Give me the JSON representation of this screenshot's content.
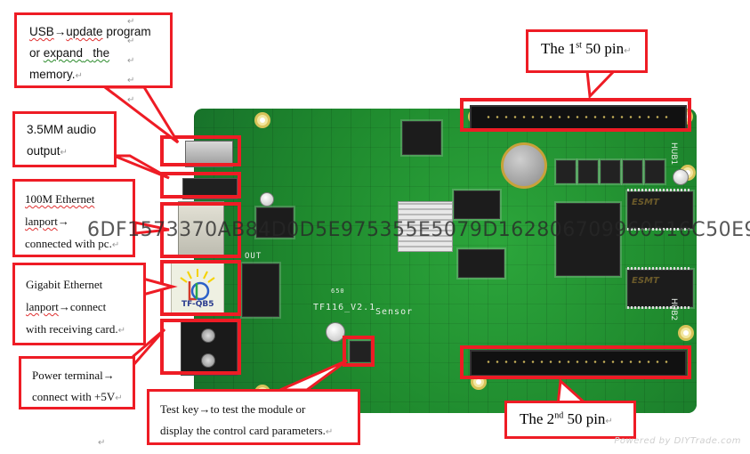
{
  "callouts": {
    "usb": {
      "line1_a": "USB",
      "line1_arrow": "→",
      "line1_b": "update",
      "line1_c": " program",
      "line2_a": "or ",
      "line2_b": "expand",
      "line2_c": "   ",
      "line2_d": "the",
      "line3": "memory.",
      "return_mark": "↵"
    },
    "audio": {
      "line1": "3.5MM audio",
      "line2": "output",
      "return_mark": "↵"
    },
    "ethernet100": {
      "line1": "100M Ethernet",
      "line2_a": "lanport",
      "line2_arrow": "→",
      "line3": "connected with pc.",
      "return_mark": "↵"
    },
    "gigabit": {
      "line1": "Gigabit Ethernet",
      "line2_a": "lanport",
      "line2_b": "→connect",
      "line3": "with receiving card.",
      "return_mark": "↵"
    },
    "power": {
      "line1": "Power terminal→",
      "line2": "connect with +5V",
      "return_mark": "↵"
    },
    "testkey": {
      "line1": "Test key→to test the module or",
      "line2": "display the control card parameters.",
      "return_mark": "↵"
    },
    "pin1": {
      "prefix": "The 1",
      "sup": "st",
      "suffix": " 50 pin",
      "return_mark": "↵"
    },
    "pin2": {
      "prefix": "The 2",
      "sup": "nd",
      "suffix": " 50 pin",
      "return_mark": "↵"
    }
  },
  "board": {
    "model_label": "TF116_V2.1",
    "sensor_label": "Sensor",
    "logo_text": "TF-QB5",
    "out_label": "OUT",
    "hub1_label": "HUB1",
    "hub2_label": "HUB2",
    "chip_brand": "ESMT",
    "silk_650": "650"
  },
  "watermark": "6DF1573370AB84D0D5E975355E5079D162806709960516C50E9",
  "footer": {
    "powered_by": "Powered by DIYTrade.com",
    "bottom_return_mark": "↵"
  },
  "colors": {
    "highlight_red": "#ee1c25",
    "pcb_green": "#1f8a2e"
  }
}
